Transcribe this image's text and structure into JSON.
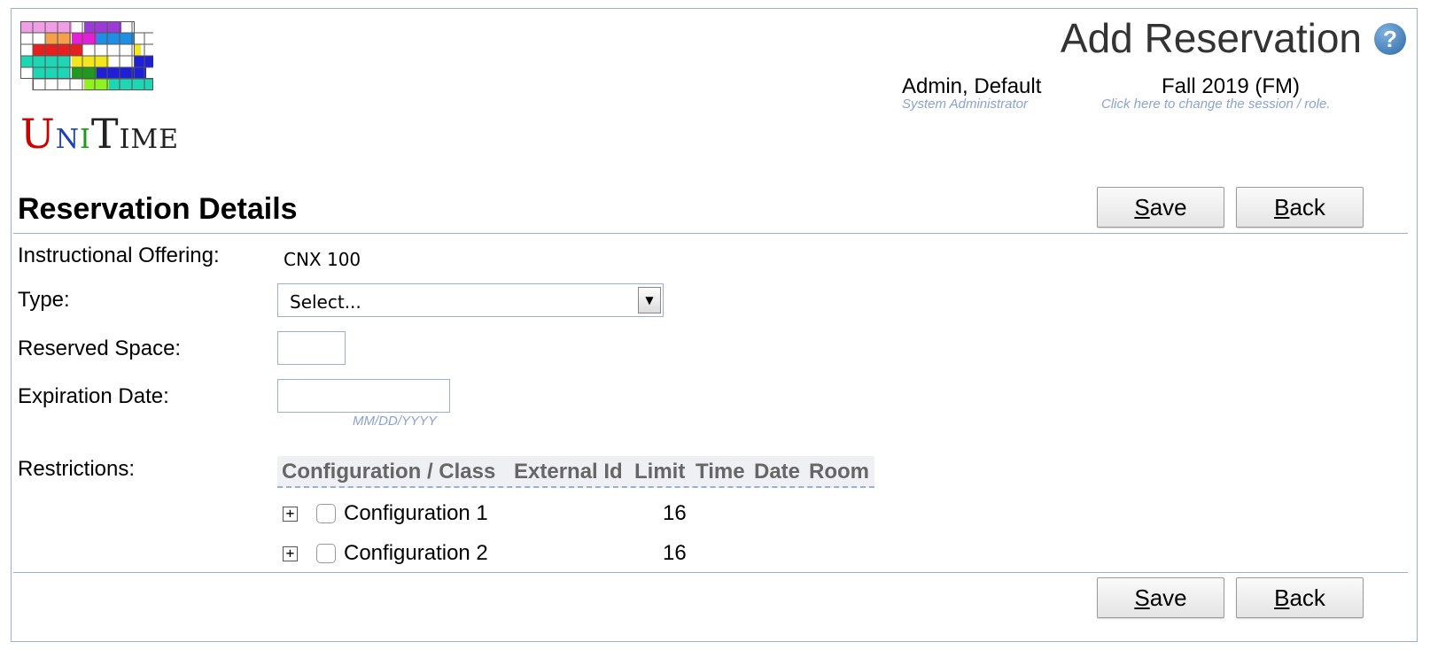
{
  "app": {
    "logo_text": "UniTime",
    "colors": {
      "border": "#9cb0ce",
      "hint": "#8aa3cf",
      "header_bg": "#eef0f4"
    }
  },
  "header": {
    "title": "Add Reservation",
    "help_icon": "help-icon",
    "user": {
      "name": "Admin, Default",
      "role": "System Administrator"
    },
    "session": {
      "name": "Fall 2019 (FM)",
      "hint": "Click here to change the session / role."
    }
  },
  "section": {
    "title": "Reservation Details"
  },
  "buttons": {
    "save": {
      "prefix": "",
      "accel": "S",
      "rest": "ave"
    },
    "back": {
      "prefix": "",
      "accel": "B",
      "rest": "ack"
    }
  },
  "form": {
    "offering": {
      "label": "Instructional Offering:",
      "value": "CNX 100"
    },
    "type": {
      "label": "Type:",
      "selected": "Select..."
    },
    "reserved_space": {
      "label": "Reserved Space:",
      "value": ""
    },
    "expiration_date": {
      "label": "Expiration Date:",
      "value": "",
      "hint": "MM/DD/YYYY"
    },
    "restrictions": {
      "label": "Restrictions:",
      "columns": [
        "Configuration / Class",
        "External Id",
        "Limit",
        "Time",
        "Date",
        "Room"
      ],
      "rows": [
        {
          "expander": "+",
          "checked": false,
          "name": "Configuration 1",
          "limit": "16"
        },
        {
          "expander": "+",
          "checked": false,
          "name": "Configuration 2",
          "limit": "16"
        }
      ]
    }
  }
}
